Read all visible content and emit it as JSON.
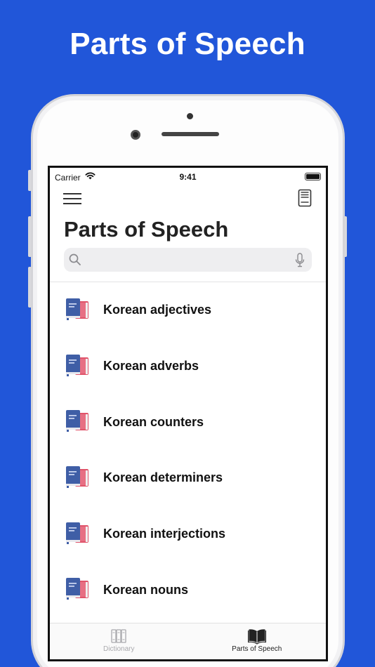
{
  "headline": "Parts of Speech",
  "status": {
    "carrier": "Carrier",
    "time": "9:41"
  },
  "page": {
    "title": "Parts of Speech"
  },
  "search": {
    "placeholder": ""
  },
  "items": [
    {
      "label": "Korean adjectives"
    },
    {
      "label": "Korean adverbs"
    },
    {
      "label": "Korean counters"
    },
    {
      "label": "Korean determiners"
    },
    {
      "label": "Korean interjections"
    },
    {
      "label": "Korean nouns"
    }
  ],
  "tabs": [
    {
      "label": "Dictionary",
      "icon": "dictionary-icon"
    },
    {
      "label": "Parts of Speech",
      "icon": "open-book-icon"
    }
  ],
  "colors": {
    "background": "#2156d9",
    "book_blue": "#3f5ea6",
    "book_red": "#e0546a"
  }
}
